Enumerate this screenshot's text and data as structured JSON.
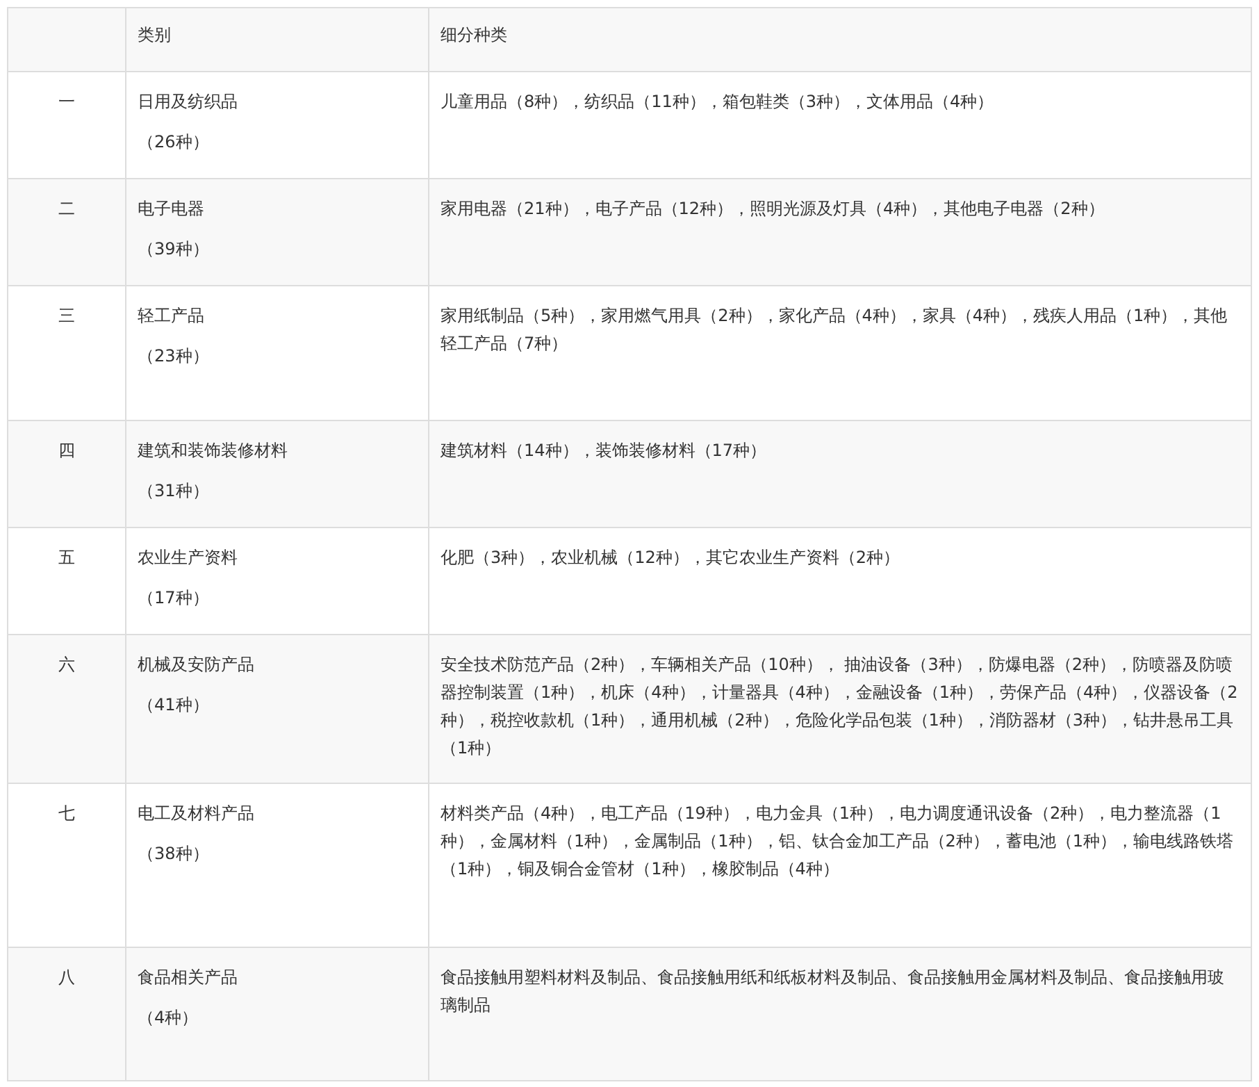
{
  "table": {
    "columns": [
      "类别",
      "细分种类"
    ],
    "rows": [
      {
        "number": "一",
        "category": "日用及纺织品",
        "count": "（26种）",
        "subcategories": "儿童用品（8种），纺织品（11种），箱包鞋类（3种），文体用品（4种）"
      },
      {
        "number": "二",
        "category": "电子电器",
        "count": "（39种）",
        "subcategories": "家用电器（21种），电子产品（12种），照明光源及灯具（4种），其他电子电器（2种）"
      },
      {
        "number": "三",
        "category": "轻工产品",
        "count": "（23种）",
        "subcategories": "家用纸制品（5种），家用燃气用具（2种），家化产品（4种），家具（4种），残疾人用品（1种），其他轻工产品（7种）"
      },
      {
        "number": "四",
        "category": "建筑和装饰装修材料",
        "count": "（31种）",
        "subcategories": "建筑材料（14种），装饰装修材料（17种）"
      },
      {
        "number": "五",
        "category": "农业生产资料",
        "count": "（17种）",
        "subcategories": "化肥（3种），农业机械（12种），其它农业生产资料（2种）"
      },
      {
        "number": "六",
        "category": "机械及安防产品",
        "count": "（41种）",
        "subcategories": "安全技术防范产品（2种），车辆相关产品（10种）， 抽油设备（3种），防爆电器（2种），防喷器及防喷器控制装置（1种），机床（4种），计量器具（4种），金融设备（1种），劳保产品（4种），仪器设备（2种），税控收款机（1种），通用机械（2种），危险化学品包装（1种），消防器材（3种），钻井悬吊工具（1种）"
      },
      {
        "number": "七",
        "category": "电工及材料产品",
        "count": "（38种）",
        "subcategories": "材料类产品（4种），电工产品（19种），电力金具（1种），电力调度通讯设备（2种），电力整流器（1种），金属材料（1种），金属制品（1种），铝、钛合金加工产品（2种），蓄电池（1种），输电线路铁塔（1种），铜及铜合金管材（1种），橡胶制品（4种）"
      },
      {
        "number": "八",
        "category": "食品相关产品",
        "count": "（4种）",
        "subcategories": "食品接触用塑料材料及制品、食品接触用纸和纸板材料及制品、食品接触用金属材料及制品、食品接触用玻璃制品"
      }
    ]
  }
}
